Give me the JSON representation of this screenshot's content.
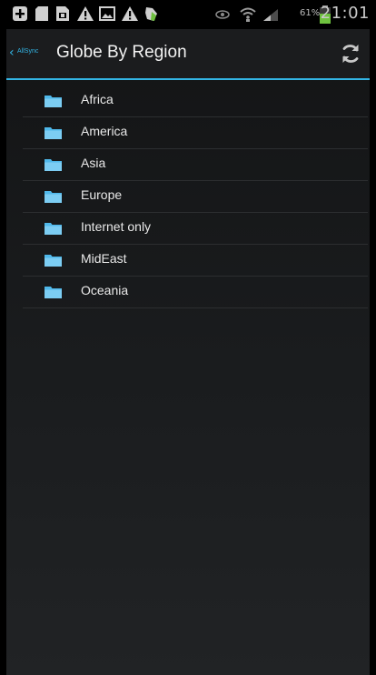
{
  "status_bar": {
    "icons": [
      "add-icon",
      "sd-card-icon",
      "sim-icon",
      "warning-icon",
      "image-icon",
      "warning-icon",
      "flame-icon",
      "eye-icon",
      "wifi-icon",
      "signal-icon",
      "battery-icon"
    ],
    "battery_text": "61%",
    "battery_level": 0.61,
    "time": "21:01"
  },
  "action_bar": {
    "back_icon": "chevron-left-icon",
    "logo_text": "AllSync",
    "title": "Globe By Region",
    "refresh_icon": "refresh-icon"
  },
  "folders": [
    {
      "label": "Africa"
    },
    {
      "label": "America"
    },
    {
      "label": "Asia"
    },
    {
      "label": "Europe"
    },
    {
      "label": "Internet only"
    },
    {
      "label": "MidEast"
    },
    {
      "label": "Oceania"
    }
  ],
  "colors": {
    "accent": "#33b5e5",
    "folder": "#4fb8ea",
    "background": "#17191b"
  }
}
